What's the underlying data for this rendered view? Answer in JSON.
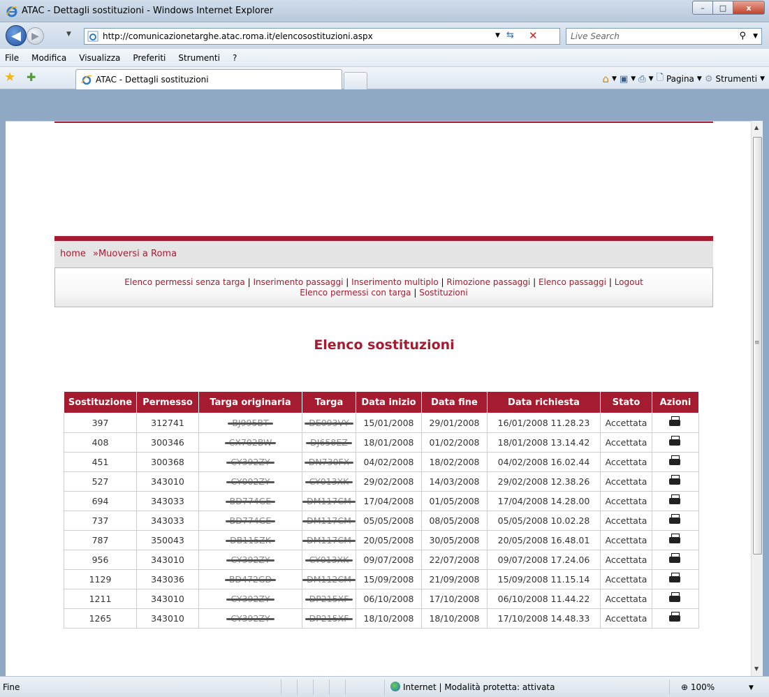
{
  "window": {
    "title": "ATAC - Dettagli sostituzioni - Windows Internet Explorer",
    "controls": {
      "minimize": "–",
      "maximize": "□",
      "close": "x"
    }
  },
  "address": {
    "url": "http://comunicazionetarghe.atac.roma.it/elencosostituzioni.aspx",
    "search_placeholder": "Live Search"
  },
  "menu": [
    "File",
    "Modifica",
    "Visualizza",
    "Preferiti",
    "Strumenti",
    "?"
  ],
  "tab": {
    "label": "ATAC - Dettagli sostituzioni"
  },
  "commands": {
    "page": "Pagina",
    "tools": "Strumenti"
  },
  "breadcrumb": {
    "home": "home",
    "section": "»Muoversi a Roma"
  },
  "site_menu": {
    "links": [
      "Elenco permessi senza targa",
      "Inserimento passaggi",
      "Inserimento multiplo",
      "Rimozione passaggi",
      "Elenco passaggi",
      "Logout"
    ],
    "links2": [
      "Elenco permessi con targa",
      "Sostituzioni"
    ]
  },
  "page_title": "Elenco sostituzioni",
  "table": {
    "headers": [
      "Sostituzione",
      "Permesso",
      "Targa originaria",
      "Targa",
      "Data inizio",
      "Data fine",
      "Data richiesta",
      "Stato",
      "Azioni"
    ],
    "rows": [
      [
        "397",
        "312741",
        "BJ995BT",
        "DE093VY",
        "15/01/2008",
        "29/01/2008",
        "16/01/2008 11.28.23",
        "Accettata"
      ],
      [
        "408",
        "300346",
        "CX702BW",
        "DJ658EZ",
        "18/01/2008",
        "01/02/2008",
        "18/01/2008 13.14.42",
        "Accettata"
      ],
      [
        "451",
        "300368",
        "CY392ZY",
        "DN730FX",
        "04/02/2008",
        "18/02/2008",
        "04/02/2008 16.02.44",
        "Accettata"
      ],
      [
        "527",
        "343010",
        "CY002ZY",
        "CY013XK",
        "29/02/2008",
        "14/03/2008",
        "29/02/2008 12.38.26",
        "Accettata"
      ],
      [
        "694",
        "343033",
        "BD774GE",
        "DM117CM",
        "17/04/2008",
        "01/05/2008",
        "17/04/2008 14.28.00",
        "Accettata"
      ],
      [
        "737",
        "343033",
        "BD774GE",
        "DM117CM",
        "05/05/2008",
        "08/05/2008",
        "05/05/2008 10.02.28",
        "Accettata"
      ],
      [
        "787",
        "350043",
        "DB115ZK",
        "DM117CM",
        "20/05/2008",
        "30/05/2008",
        "20/05/2008 16.48.01",
        "Accettata"
      ],
      [
        "956",
        "343010",
        "CY392ZY",
        "CY013XK",
        "09/07/2008",
        "22/07/2008",
        "09/07/2008 17.24.06",
        "Accettata"
      ],
      [
        "1129",
        "343036",
        "BD472GD",
        "DM112CM",
        "15/09/2008",
        "21/09/2008",
        "15/09/2008 11.15.14",
        "Accettata"
      ],
      [
        "1211",
        "343010",
        "CY392ZY",
        "DP215XF",
        "06/10/2008",
        "17/10/2008",
        "06/10/2008 11.44.22",
        "Accettata"
      ],
      [
        "1265",
        "343010",
        "CY392ZY",
        "DP215XF",
        "18/10/2008",
        "18/10/2008",
        "17/10/2008 14.48.33",
        "Accettata"
      ]
    ]
  },
  "status": {
    "left": "Fine",
    "zone": "Internet | Modalità protetta: attivata",
    "zoom": "100%"
  },
  "colors": {
    "brand_red": "#a51c30",
    "breadcrumb_bg": "#e5e5e5"
  }
}
